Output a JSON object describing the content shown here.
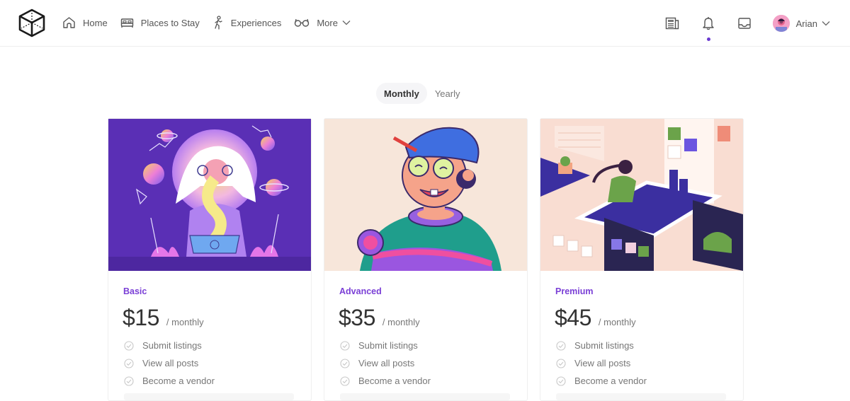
{
  "header": {
    "logo": "cube-logo",
    "nav": [
      {
        "label": "Home",
        "icon": "home-icon"
      },
      {
        "label": "Places to Stay",
        "icon": "bed-icon"
      },
      {
        "label": "Experiences",
        "icon": "hiking-icon"
      },
      {
        "label": "More",
        "icon": "glasses-icon",
        "has_dropdown": true
      }
    ],
    "actions": [
      {
        "icon": "newspaper-icon"
      },
      {
        "icon": "bell-icon",
        "notification_dot": true
      },
      {
        "icon": "inbox-icon"
      }
    ],
    "user": {
      "name": "Arian",
      "has_dropdown": true
    }
  },
  "billing_toggle": {
    "options": [
      "Monthly",
      "Yearly"
    ],
    "selected": "Monthly"
  },
  "accent_color": "#7a3fd6",
  "plans": [
    {
      "name": "Basic",
      "price": "$15",
      "period": "/ monthly",
      "illustration": "woman-eating-cosmic-noodles",
      "features": [
        "Submit listings",
        "View all posts",
        "Become a vendor"
      ]
    },
    {
      "name": "Advanced",
      "price": "$35",
      "period": "/ monthly",
      "illustration": "boy-with-cap-and-glasses",
      "features": [
        "Submit listings",
        "View all posts",
        "Become a vendor"
      ]
    },
    {
      "name": "Premium",
      "price": "$45",
      "period": "/ monthly",
      "illustration": "woman-at-isometric-desk",
      "features": [
        "Submit listings",
        "View all posts",
        "Become a vendor"
      ]
    }
  ]
}
